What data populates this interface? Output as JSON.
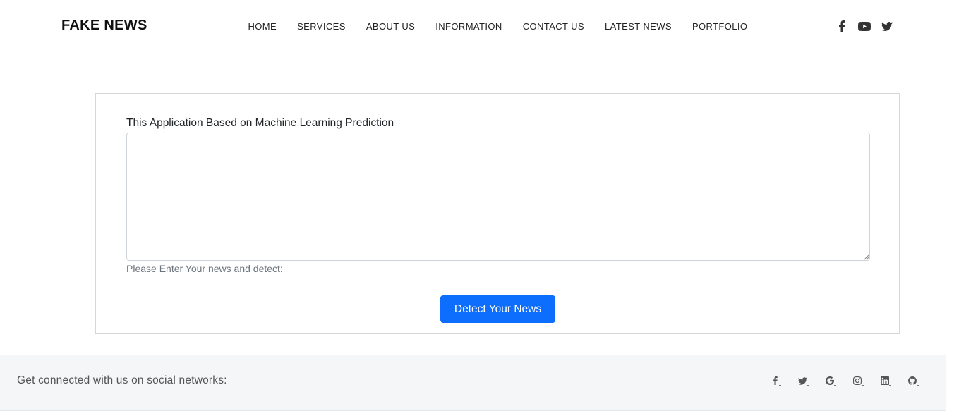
{
  "header": {
    "brand": "FAKE NEWS",
    "nav": [
      {
        "label": "HOME"
      },
      {
        "label": "SERVICES"
      },
      {
        "label": "ABOUT US"
      },
      {
        "label": "INFORMATION"
      },
      {
        "label": "CONTACT US"
      },
      {
        "label": "LATEST NEWS"
      },
      {
        "label": "PORTFOLIO"
      }
    ],
    "social_icons": [
      "facebook-icon",
      "youtube-icon",
      "twitter-icon"
    ]
  },
  "form": {
    "label": "This Application Based on Machine Learning Prediction",
    "textarea_value": "",
    "help_text": "Please Enter Your news and detect:",
    "submit_label": "Detect Your News",
    "button_color": "#0d6efd"
  },
  "footer": {
    "text": "Get connected with us on social networks:",
    "social_icons": [
      "facebook-icon",
      "twitter-icon",
      "google-icon",
      "instagram-icon",
      "linkedin-icon",
      "github-icon"
    ]
  }
}
